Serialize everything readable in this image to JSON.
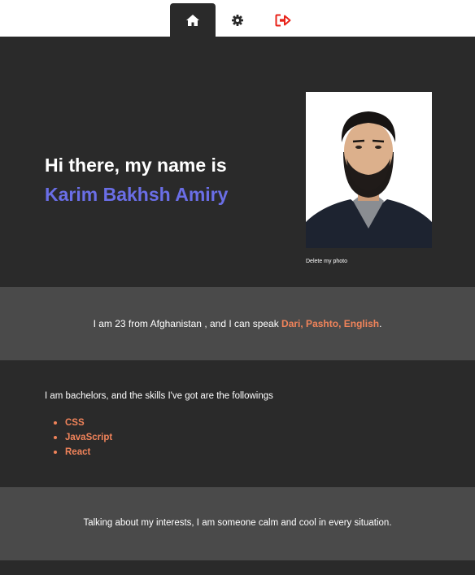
{
  "nav": {
    "home_icon": "home-icon",
    "settings_icon": "gear-icon",
    "logout_icon": "sign-out-icon",
    "accent_color": "#e8231a"
  },
  "hero": {
    "greeting": "Hi there, my name is",
    "name": "Karim Bakhsh Amiry",
    "delete_photo_label": "Delete my photo",
    "name_color": "#6a6ee6"
  },
  "about": {
    "text_before": "I am 23 from Afghanistan , and I can speak ",
    "languages": "Dari, Pashto, English",
    "text_after": "."
  },
  "skills": {
    "intro": "I am bachelors, and the skills I've got are the followings",
    "items": [
      "CSS",
      "JavaScript",
      "React"
    ]
  },
  "interests": {
    "text": "Talking about my interests, I am someone calm and cool in every situation."
  },
  "colors": {
    "dark_bg": "#2a2a2a",
    "light_band": "#4a4a4a",
    "highlight": "#f0835a"
  }
}
